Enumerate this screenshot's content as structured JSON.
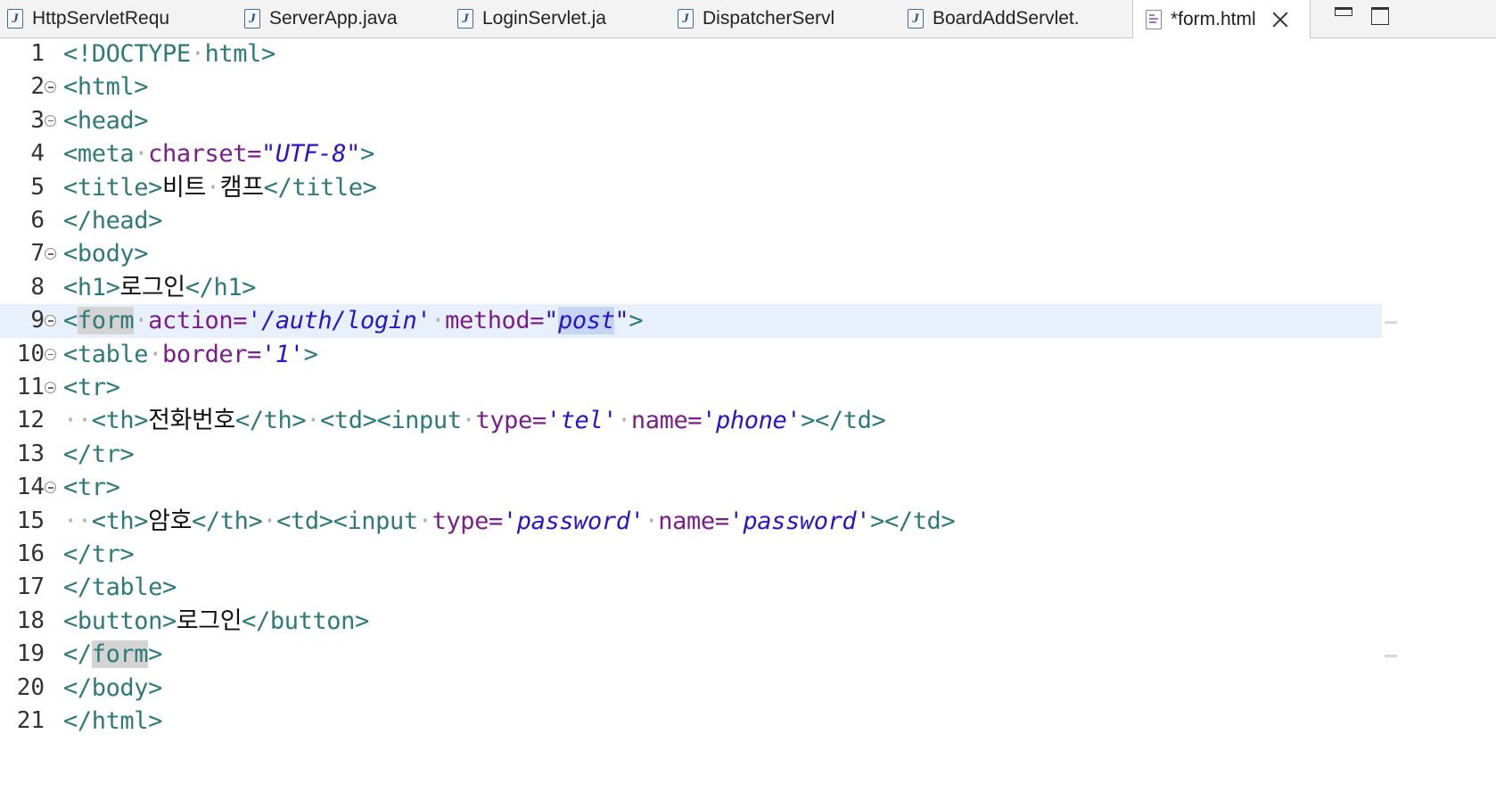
{
  "tabs": [
    {
      "label": "HttpServletRequ",
      "icon": "java-file-icon"
    },
    {
      "label": "ServerApp.java",
      "icon": "java-file-icon"
    },
    {
      "label": "LoginServlet.ja",
      "icon": "java-file-icon"
    },
    {
      "label": "DispatcherServl",
      "icon": "java-file-icon"
    },
    {
      "label": "BoardAddServlet.",
      "icon": "java-file-icon"
    },
    {
      "label": "*form.html",
      "icon": "html-file-icon",
      "active": true
    }
  ],
  "editor": {
    "current_line": 9,
    "lines": [
      {
        "n": "1"
      },
      {
        "n": "2"
      },
      {
        "n": "3"
      },
      {
        "n": "4"
      },
      {
        "n": "5"
      },
      {
        "n": "6"
      },
      {
        "n": "7"
      },
      {
        "n": "8"
      },
      {
        "n": "9"
      },
      {
        "n": "10"
      },
      {
        "n": "11"
      },
      {
        "n": "12"
      },
      {
        "n": "13"
      },
      {
        "n": "14"
      },
      {
        "n": "15"
      },
      {
        "n": "16"
      },
      {
        "n": "17"
      },
      {
        "n": "18"
      },
      {
        "n": "19"
      },
      {
        "n": "20"
      },
      {
        "n": "21"
      }
    ],
    "text": {
      "doctype": "<!DOCTYPE",
      "doctype_html": "html>",
      "html_open": "<html>",
      "head_open": "<head>",
      "meta_open": "<meta",
      "charset_attr": "charset=",
      "charset_val": "\"UTF-8\"",
      "gt": ">",
      "title_open": "<title>",
      "title_text_1": "비트",
      "title_text_2": "캠프",
      "title_close": "</title>",
      "head_close": "</head>",
      "body_open": "<body>",
      "h1_open": "<h1>",
      "h1_text": "로그인",
      "h1_close": "</h1>",
      "form_lt": "<",
      "form_name": "form",
      "action_attr": "action=",
      "action_val": "'/auth/login'",
      "method_attr": "method=",
      "method_q1": "\"",
      "method_val": "post",
      "method_q2": "\"",
      "table_open": "<table",
      "border_attr": "border=",
      "border_val": "'1'",
      "tr_open": "<tr>",
      "th_open": "<th>",
      "th_phone": "전화번호",
      "th_close": "</th>",
      "td_open": "<td><input",
      "type_attr": "type=",
      "tel_val": "'tel'",
      "name_attr": "name=",
      "phone_val": "'phone'",
      "td_close": "></td>",
      "tr_close": "</tr>",
      "th_pw": "암호",
      "password_val": "'password'",
      "table_close": "</table>",
      "button_open": "<button>",
      "button_text": "로그인",
      "button_close": "</button>",
      "form_close_lt": "</",
      "form_close_name": "form",
      "body_close": "</body>",
      "html_close": "</html>",
      "dot": "·"
    }
  }
}
